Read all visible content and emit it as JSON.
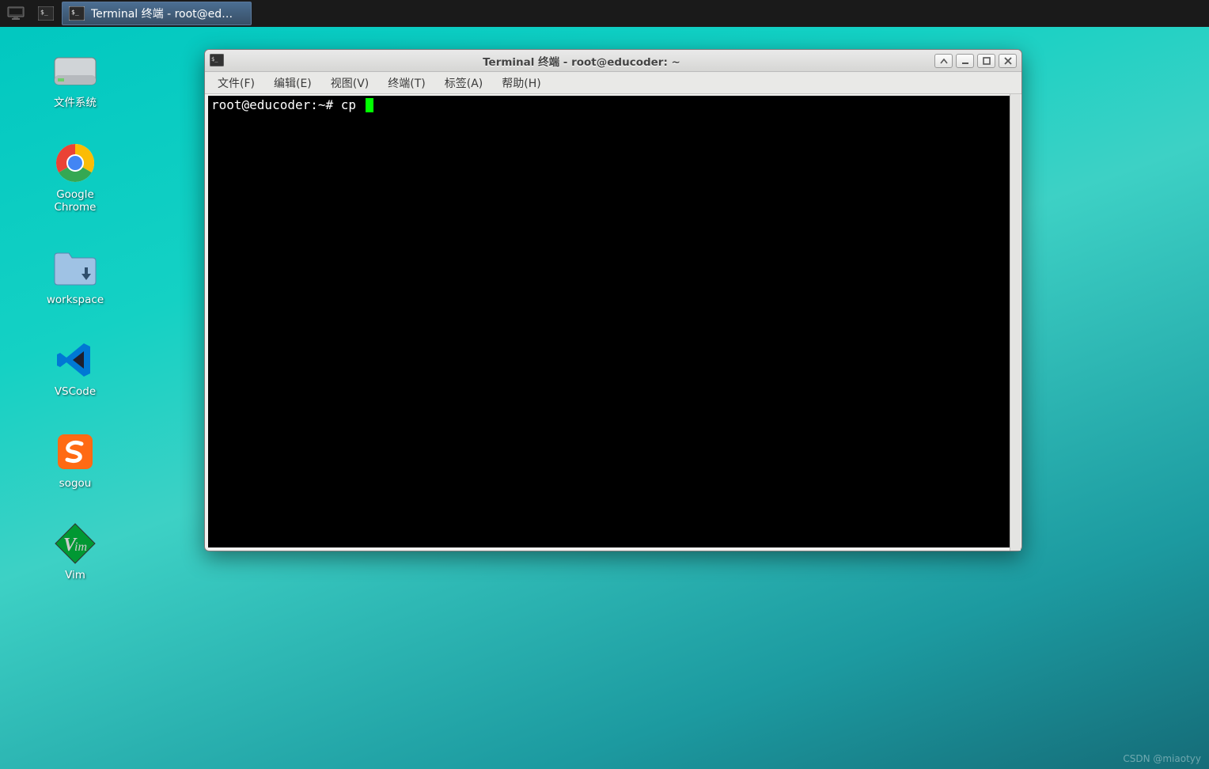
{
  "taskbar": {
    "active_label": "Terminal 终端 - root@ed…"
  },
  "desktop": {
    "icons": [
      {
        "name": "filesystem",
        "label": "文件系统"
      },
      {
        "name": "chrome",
        "label": "Google\nChrome"
      },
      {
        "name": "workspace",
        "label": "workspace"
      },
      {
        "name": "vscode",
        "label": "VSCode"
      },
      {
        "name": "sogou",
        "label": "sogou"
      },
      {
        "name": "vim",
        "label": "Vim"
      }
    ]
  },
  "window": {
    "title": "Terminal 终端 - root@educoder: ~",
    "menus": [
      "文件(F)",
      "编辑(E)",
      "视图(V)",
      "终端(T)",
      "标签(A)",
      "帮助(H)"
    ],
    "prompt": "root@educoder:~# cp "
  },
  "watermark": "CSDN @miaotyy"
}
